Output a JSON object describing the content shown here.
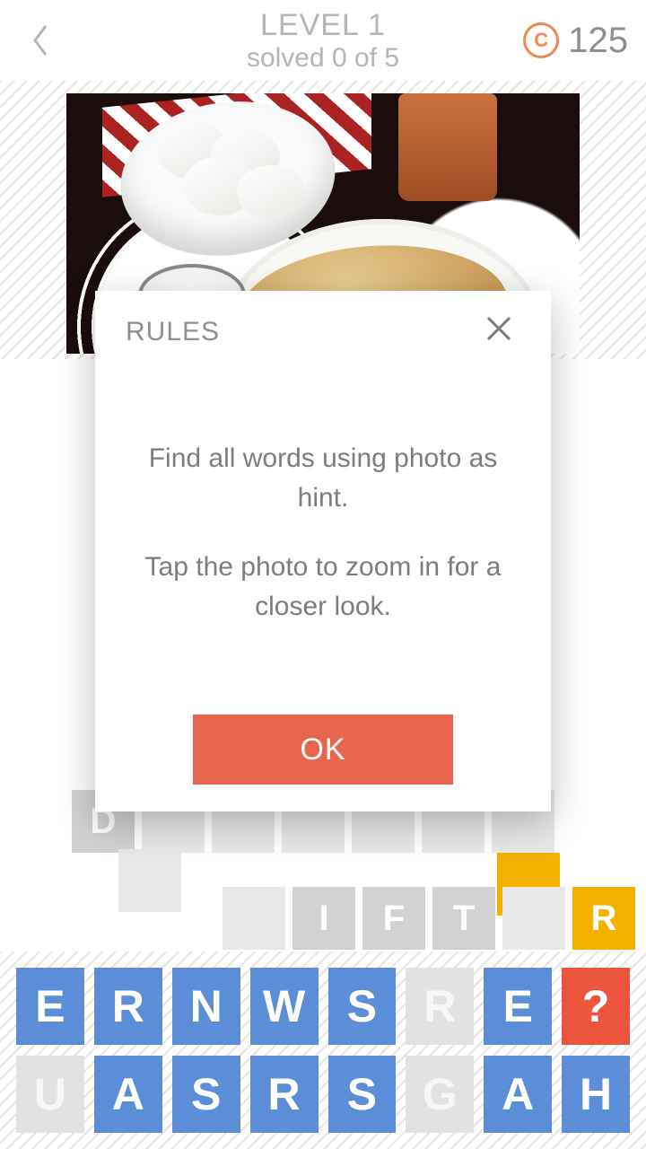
{
  "header": {
    "level_label": "LEVEL 1",
    "solved_label": "solved 0 of 5",
    "coins": "125"
  },
  "modal": {
    "title": "RULES",
    "line1": "Find all words using photo as hint.",
    "line2": "Tap the photo to zoom in for a closer look.",
    "ok_label": "OK"
  },
  "answer_tiles": {
    "d_tile": "D",
    "ift_row": [
      "",
      "I",
      "F",
      "T",
      "",
      "R"
    ]
  },
  "rack": {
    "row1": [
      {
        "ch": "E",
        "style": "blue"
      },
      {
        "ch": "R",
        "style": "blue"
      },
      {
        "ch": "N",
        "style": "blue"
      },
      {
        "ch": "W",
        "style": "blue"
      },
      {
        "ch": "S",
        "style": "blue"
      },
      {
        "ch": "R",
        "style": "faded"
      },
      {
        "ch": "E",
        "style": "blue"
      },
      {
        "ch": "?",
        "style": "red"
      }
    ],
    "row2": [
      {
        "ch": "U",
        "style": "faded"
      },
      {
        "ch": "A",
        "style": "blue"
      },
      {
        "ch": "S",
        "style": "blue"
      },
      {
        "ch": "R",
        "style": "blue"
      },
      {
        "ch": "S",
        "style": "blue"
      },
      {
        "ch": "G",
        "style": "faded"
      },
      {
        "ch": "A",
        "style": "blue"
      },
      {
        "ch": "H",
        "style": "blue"
      }
    ]
  },
  "colors": {
    "accent_red": "#e9644f",
    "tile_blue": "#5b8ed6",
    "tile_orange": "#f5b100"
  }
}
